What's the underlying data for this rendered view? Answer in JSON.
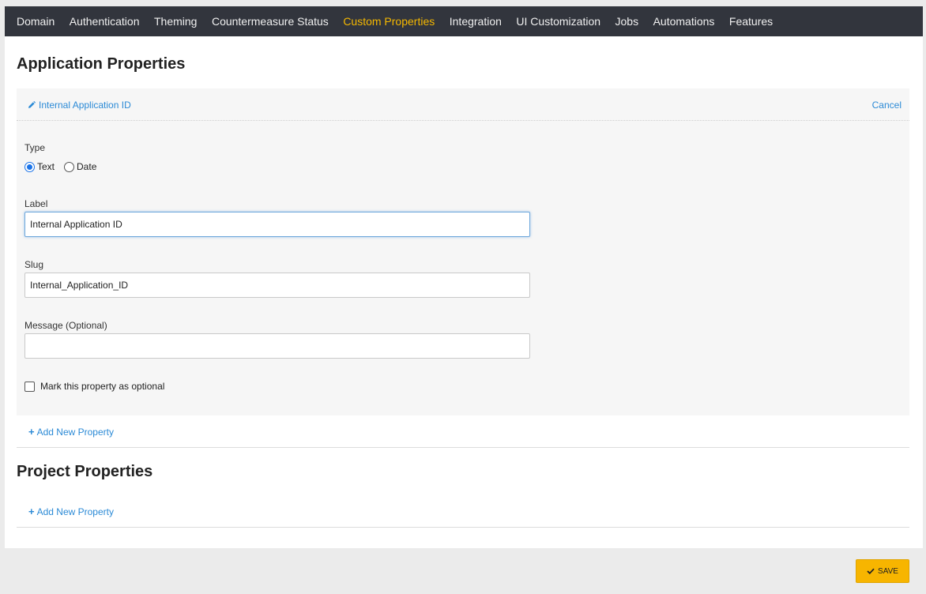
{
  "nav": {
    "items": [
      {
        "label": "Domain"
      },
      {
        "label": "Authentication"
      },
      {
        "label": "Theming"
      },
      {
        "label": "Countermeasure Status"
      },
      {
        "label": "Custom Properties"
      },
      {
        "label": "Integration"
      },
      {
        "label": "UI Customization"
      },
      {
        "label": "Jobs"
      },
      {
        "label": "Automations"
      },
      {
        "label": "Features"
      }
    ],
    "active": "Custom Properties"
  },
  "application_section": {
    "title": "Application Properties",
    "editing_property": "Internal Application ID",
    "cancel_label": "Cancel",
    "type_label": "Type",
    "type_options": [
      "Text",
      "Date"
    ],
    "type_selected": "Text",
    "label_field_label": "Label",
    "label_value": "Internal Application ID",
    "slug_field_label": "Slug",
    "slug_value": "Internal_Application_ID",
    "message_field_label": "Message (Optional)",
    "message_value": "",
    "optional_checkbox_label": "Mark this property as optional",
    "optional_checked": false,
    "add_property_label": "Add New Property"
  },
  "project_section": {
    "title": "Project Properties",
    "add_property_label": "Add New Property"
  },
  "footer": {
    "save_label": "SAVE"
  },
  "colors": {
    "nav_background": "#32353d",
    "nav_active": "#f5b800",
    "link": "#2b8ad6",
    "save_button": "#f7b500"
  }
}
